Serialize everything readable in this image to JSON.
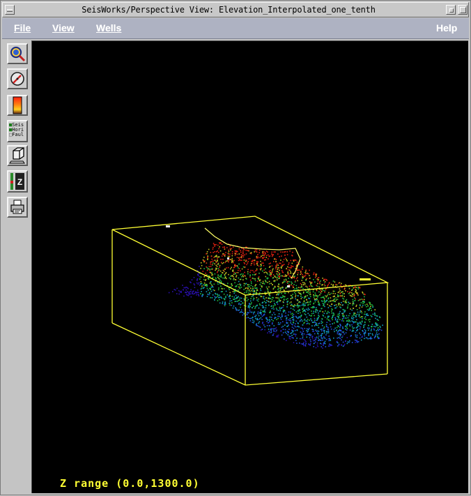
{
  "window": {
    "title": "SeisWorks/Perspective View: Elevation_Interpolated_one_tenth"
  },
  "menubar": {
    "file": "File",
    "view": "View",
    "wells": "Wells",
    "help": "Help"
  },
  "toolbar": {
    "buttons": [
      {
        "icon": "zoom-icon"
      },
      {
        "icon": "compass-rotate-icon"
      },
      {
        "icon": "color-bar-icon"
      },
      {
        "icon": "data-layers-icon",
        "labels": [
          "Seis",
          "Hori",
          "Faul"
        ]
      },
      {
        "icon": "bounding-box-icon"
      },
      {
        "icon": "z-scale-icon",
        "label": "Z"
      },
      {
        "icon": "printer-icon"
      }
    ]
  },
  "viewport": {
    "z_range_text": "Z range (0.0,1300.0)",
    "box_color": "#ffff33",
    "surface_palette": [
      "#2a10b0",
      "#2050e0",
      "#10a0c0",
      "#20c040",
      "#c0c020",
      "#e02010"
    ]
  },
  "colors": {
    "menubar_bg": "#aeb2c2",
    "window_bg": "#c4c4c4",
    "viewport_bg": "#000000"
  }
}
